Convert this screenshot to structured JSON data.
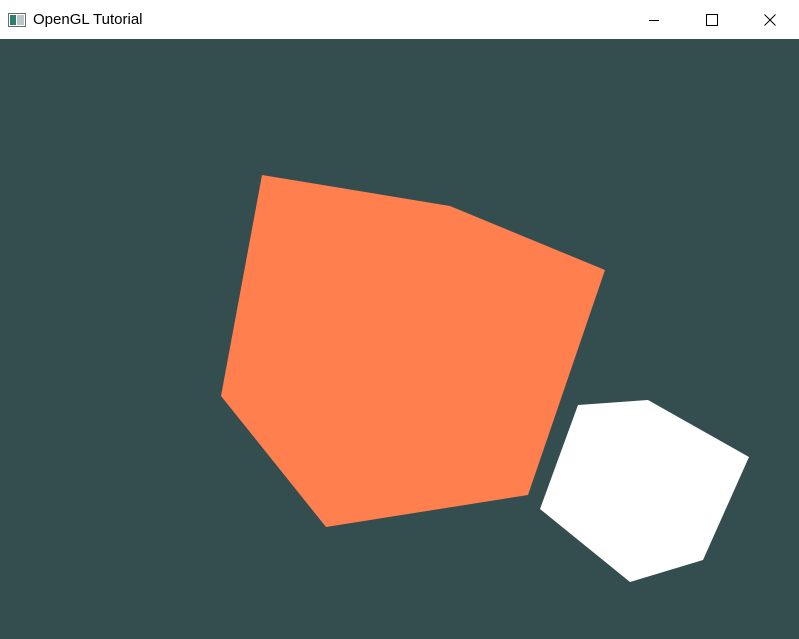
{
  "window": {
    "title": "OpenGL Tutorial",
    "app_icon": "window-app-icon",
    "controls": [
      {
        "name": "minimize-button",
        "icon": "minimize-icon"
      },
      {
        "name": "maximize-button",
        "icon": "maximize-icon"
      },
      {
        "name": "close-button",
        "icon": "close-icon"
      }
    ]
  },
  "scene": {
    "background_color": "#344d4e",
    "objects": [
      {
        "name": "orange-cube",
        "shape": "polyhedron",
        "color": "#ff7f4e"
      },
      {
        "name": "white-light-cube",
        "shape": "polyhedron",
        "color": "#ffffff"
      }
    ]
  }
}
